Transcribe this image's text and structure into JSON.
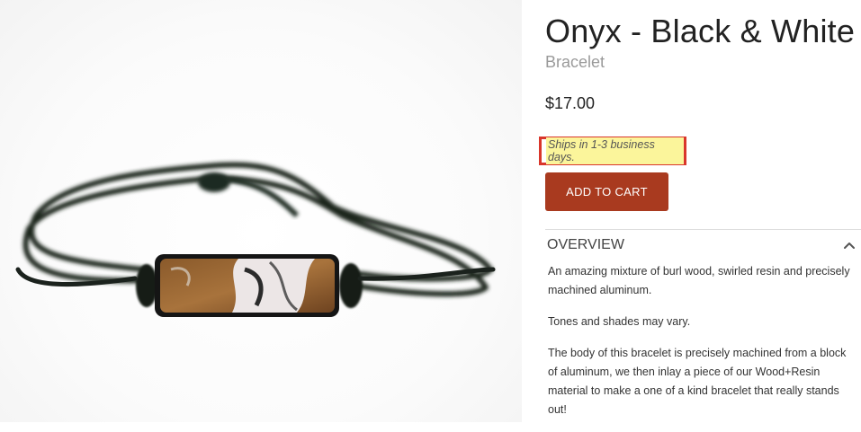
{
  "product": {
    "title": "Onyx - Black & White",
    "subtitle": "Bracelet",
    "price": "$17.00",
    "shipping_note": "Ships in 1-3 business days.",
    "add_to_cart_label": "ADD TO CART"
  },
  "overview": {
    "header": "OVERVIEW",
    "paragraphs": [
      "An amazing mixture of burl wood, swirled resin and precisely machined aluminum.",
      "Tones and shades may vary.",
      "The body of this bracelet is precisely machined from a block of aluminum, we then inlay a piece of our Wood+Resin material to make a one of a kind bracelet that really stands out!"
    ]
  },
  "icons": {
    "collapse": "chevron-up-icon"
  },
  "colors": {
    "accent_button": "#a93a1f",
    "highlight_box": "#d9362b",
    "highlight_fill": "#fbf59b"
  }
}
